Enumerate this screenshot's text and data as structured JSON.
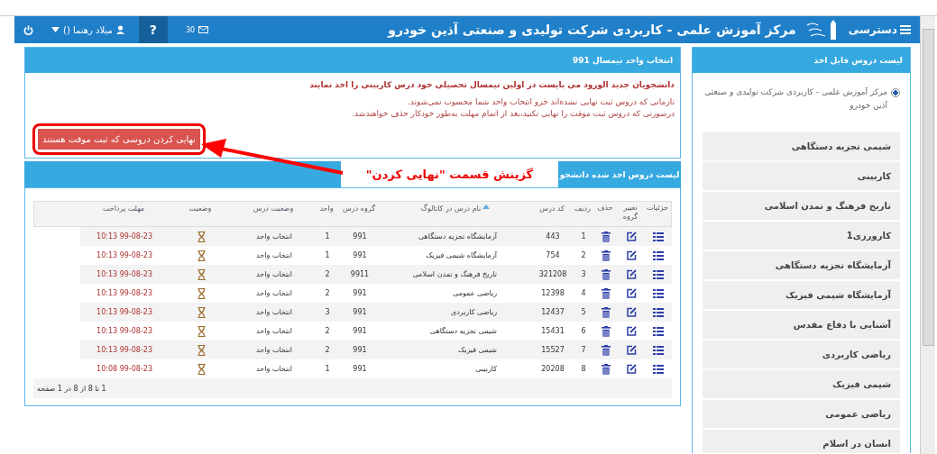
{
  "topbar": {
    "menu_label": "دسترسی",
    "title": "مرکز آموزش علمی - کاربردی شرکت تولیدی و صنعتی آذین خودرو",
    "mail_count": "30",
    "help_label": "?",
    "user_name": "میلاد رهنما ()"
  },
  "sidebar": {
    "title": "لیست دروس قابل اخذ",
    "center": {
      "label": "مرکز آموزش علمی - کاربردی شرکت تولیدی و صنعتی آذین خودرو",
      "selected": true
    },
    "items": [
      "شیمی تجزیه دستگاهی",
      "کاربینی",
      "تاریخ فرهنگ و تمدن اسلامی",
      "کارورزی1",
      "آزمایشگاه تجزیه دستگاهی",
      "آزمایشگاه شیمی فیزیک",
      "آشنایی با دفاع مقدس",
      "ریاضی کاربردی",
      "شیمی فیزیک",
      "ریاضی عمومی",
      "انسان در اسلام"
    ]
  },
  "selection_panel": {
    "title": "انتخاب واحد نیمسال 991",
    "warning": "دانشجویان جدید الورود می بایست در اولین نیمسال تحصیلی خود درس کاربینی را اخذ نمایند",
    "notes": [
      "تازمانی که دروس ثبت نهایی نشده‌اند جزو انتخاب واحد شما محسوب نمی‌شوند.",
      "درصورتی که دروس ثبت موقت را نهایی نکنید،بعد از اتمام مهلت به‌طور خودکار حذف خواهندشد."
    ],
    "finalize_button": "نهایی کردن دروسی که ثبت موقت هستند"
  },
  "annotation": "گزینش قسمت \"نهایی کردن\"",
  "courses_panel": {
    "title": "لیست دروس اخذ شده دانشجو",
    "columns": [
      "جزئیات",
      "تغییر گروه",
      "حذف",
      "ردیف",
      "کد درس",
      "نام درس در کاتالوگ",
      "گروه درس",
      "واحد",
      "وضعیت درس",
      "وضعیت",
      "مهلت پرداخت"
    ],
    "rows": [
      {
        "index": "1",
        "code": "443",
        "name": "آزمایشگاه تجزیه دستگاهی",
        "group": "991",
        "units": "1",
        "course_status": "انتخاب واحد",
        "deadline": "99-08-23 10:13"
      },
      {
        "index": "2",
        "code": "754",
        "name": "آزمایشگاه شیمی فیزیک",
        "group": "991",
        "units": "1",
        "course_status": "انتخاب واحد",
        "deadline": "99-08-23 10:13"
      },
      {
        "index": "3",
        "code": "321208",
        "name": "تاریخ فرهنگ و تمدن اسلامی",
        "group": "9911",
        "units": "2",
        "course_status": "انتخاب واحد",
        "deadline": "99-08-23 10:13"
      },
      {
        "index": "4",
        "code": "12398",
        "name": "ریاضی عمومی",
        "group": "991",
        "units": "2",
        "course_status": "انتخاب واحد",
        "deadline": "99-08-23 10:13"
      },
      {
        "index": "5",
        "code": "12437",
        "name": "ریاضی کاربردی",
        "group": "991",
        "units": "3",
        "course_status": "انتخاب واحد",
        "deadline": "99-08-23 10:13"
      },
      {
        "index": "6",
        "code": "15431",
        "name": "شیمی تجزیه دستگاهی",
        "group": "991",
        "units": "2",
        "course_status": "انتخاب واحد",
        "deadline": "99-08-23 10:13"
      },
      {
        "index": "7",
        "code": "15527",
        "name": "شیمی فیزیک",
        "group": "991",
        "units": "2",
        "course_status": "انتخاب واحد",
        "deadline": "99-08-23 10:13"
      },
      {
        "index": "8",
        "code": "20208",
        "name": "کاربینی",
        "group": "991",
        "units": "1",
        "course_status": "انتخاب واحد",
        "deadline": "99-08-23 10:08"
      }
    ],
    "pagination": "1 تا 8 از 8 در 1 صفحه"
  }
}
